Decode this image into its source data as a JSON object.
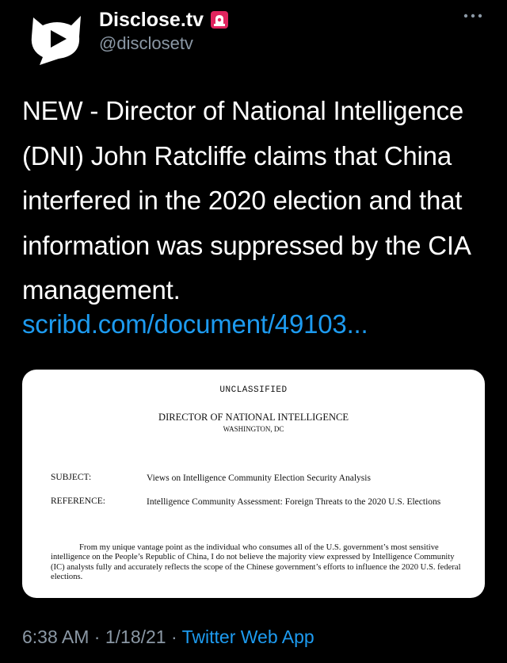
{
  "author": {
    "display_name": "Disclose.tv",
    "handle": "@disclosetv"
  },
  "tweet": {
    "text": "NEW - Director of National Intelligence (DNI) John Ratcliffe claims that China interfered in the 2020 election and that information was suppressed by the CIA management.",
    "link": "scribd.com/document/49103..."
  },
  "document": {
    "classification": "UNCLASSIFIED",
    "office": "DIRECTOR OF NATIONAL INTELLIGENCE",
    "location": "WASHINGTON, DC",
    "subject_label": "SUBJECT:",
    "subject_value": "Views on Intelligence Community Election Security Analysis",
    "reference_label": "REFERENCE:",
    "reference_value": "Intelligence Community Assessment: Foreign Threats to the 2020 U.S. Elections",
    "body": "From my unique vantage point as the individual who consumes all of the U.S. government’s most sensitive intelligence on the People’s Republic of China, I do not believe the majority view expressed by Intelligence Community (IC) analysts fully and accurately reflects the scope of the Chinese government’s efforts to influence the 2020 U.S. federal elections."
  },
  "footer": {
    "time": "6:38 AM",
    "separator1": "·",
    "date": "1/18/21",
    "separator2": "·",
    "source": "Twitter Web App"
  },
  "icons": {
    "avatar": "disclose-tv-logo",
    "badge": "siren-icon",
    "more": "more-options-icon"
  },
  "colors": {
    "background": "#000000",
    "text": "#ffffff",
    "secondary_text": "#8b98a5",
    "link": "#1d9bf0",
    "badge_red": "#e0245e"
  }
}
